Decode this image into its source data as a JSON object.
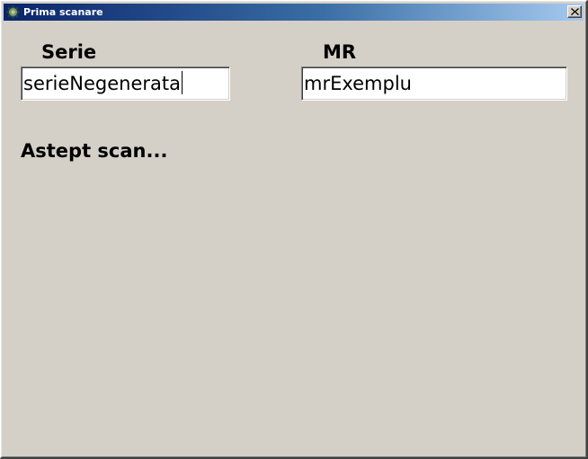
{
  "window": {
    "title": "Prima scanare",
    "icon": "gear-icon",
    "close_glyph": "close-icon"
  },
  "form": {
    "serie": {
      "label": "Serie",
      "value": "serieNegenerata"
    },
    "mr": {
      "label": "MR",
      "value": "mrExemplu"
    }
  },
  "status": {
    "text": "Astept scan..."
  },
  "colors": {
    "background": "#d4d0c8",
    "titlebar_start": "#0a246a",
    "titlebar_end": "#a6caf0",
    "title_text": "#ffffff"
  }
}
